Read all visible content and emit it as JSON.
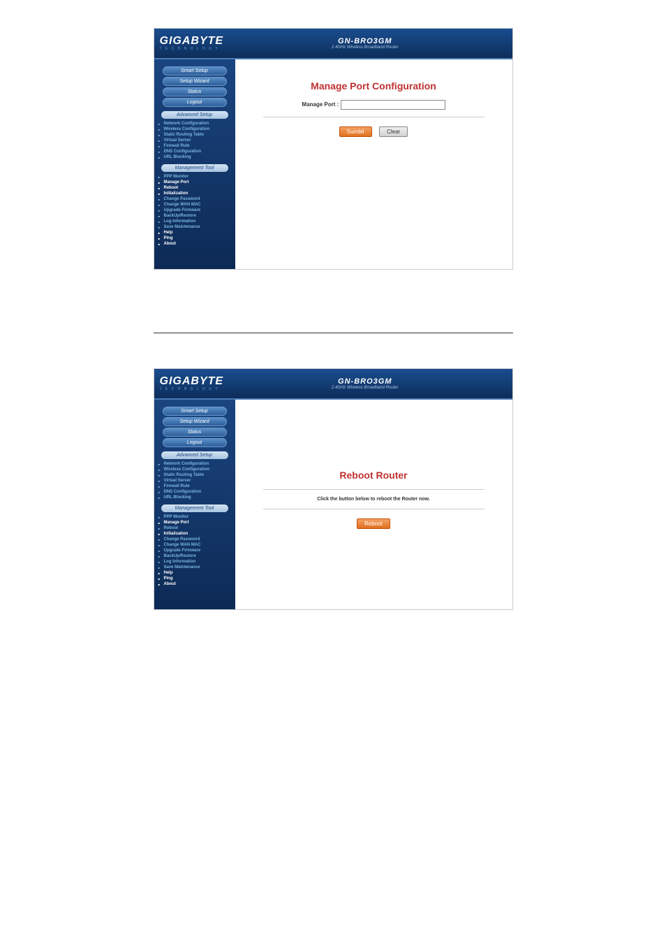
{
  "brand": {
    "name": "GIGABYTE",
    "tagline": "T E C H N O L O G Y"
  },
  "product": {
    "model": "GN-BRO3GM",
    "subtitle": "2.4GHz Wireless Broadband Router"
  },
  "nav": {
    "top_buttons": [
      {
        "label": "Smart Setup"
      },
      {
        "label": "Setup Wizard"
      },
      {
        "label": "Status"
      },
      {
        "label": "Logout"
      }
    ],
    "advanced_header": "Advanced Setup",
    "advanced_items": [
      "Network Configuration",
      "Wireless Configuration",
      "Static Routing Table",
      "Virtual Server",
      "Firewall Rule",
      "DNS Configuration",
      "URL Blocking"
    ],
    "management_header": "Management Tool",
    "management_items": [
      "PPP Monitor",
      "Manage Port",
      "Reboot",
      "Initialization",
      "Change Password",
      "Change WAN MAC",
      "Upgrade Firmware",
      "BackUp/Restore",
      "Log Information",
      "Save Maintenance",
      "Help",
      "Ping",
      "About"
    ]
  },
  "screen1": {
    "title": "Manage Port Configuration",
    "field_label": "Manage Port :",
    "submit_label": "Sumbit",
    "clear_label": "Clear"
  },
  "screen2": {
    "title": "Reboot Router",
    "subtitle": "Click the button below to reboot the Router now.",
    "reboot_label": "Reboot"
  }
}
